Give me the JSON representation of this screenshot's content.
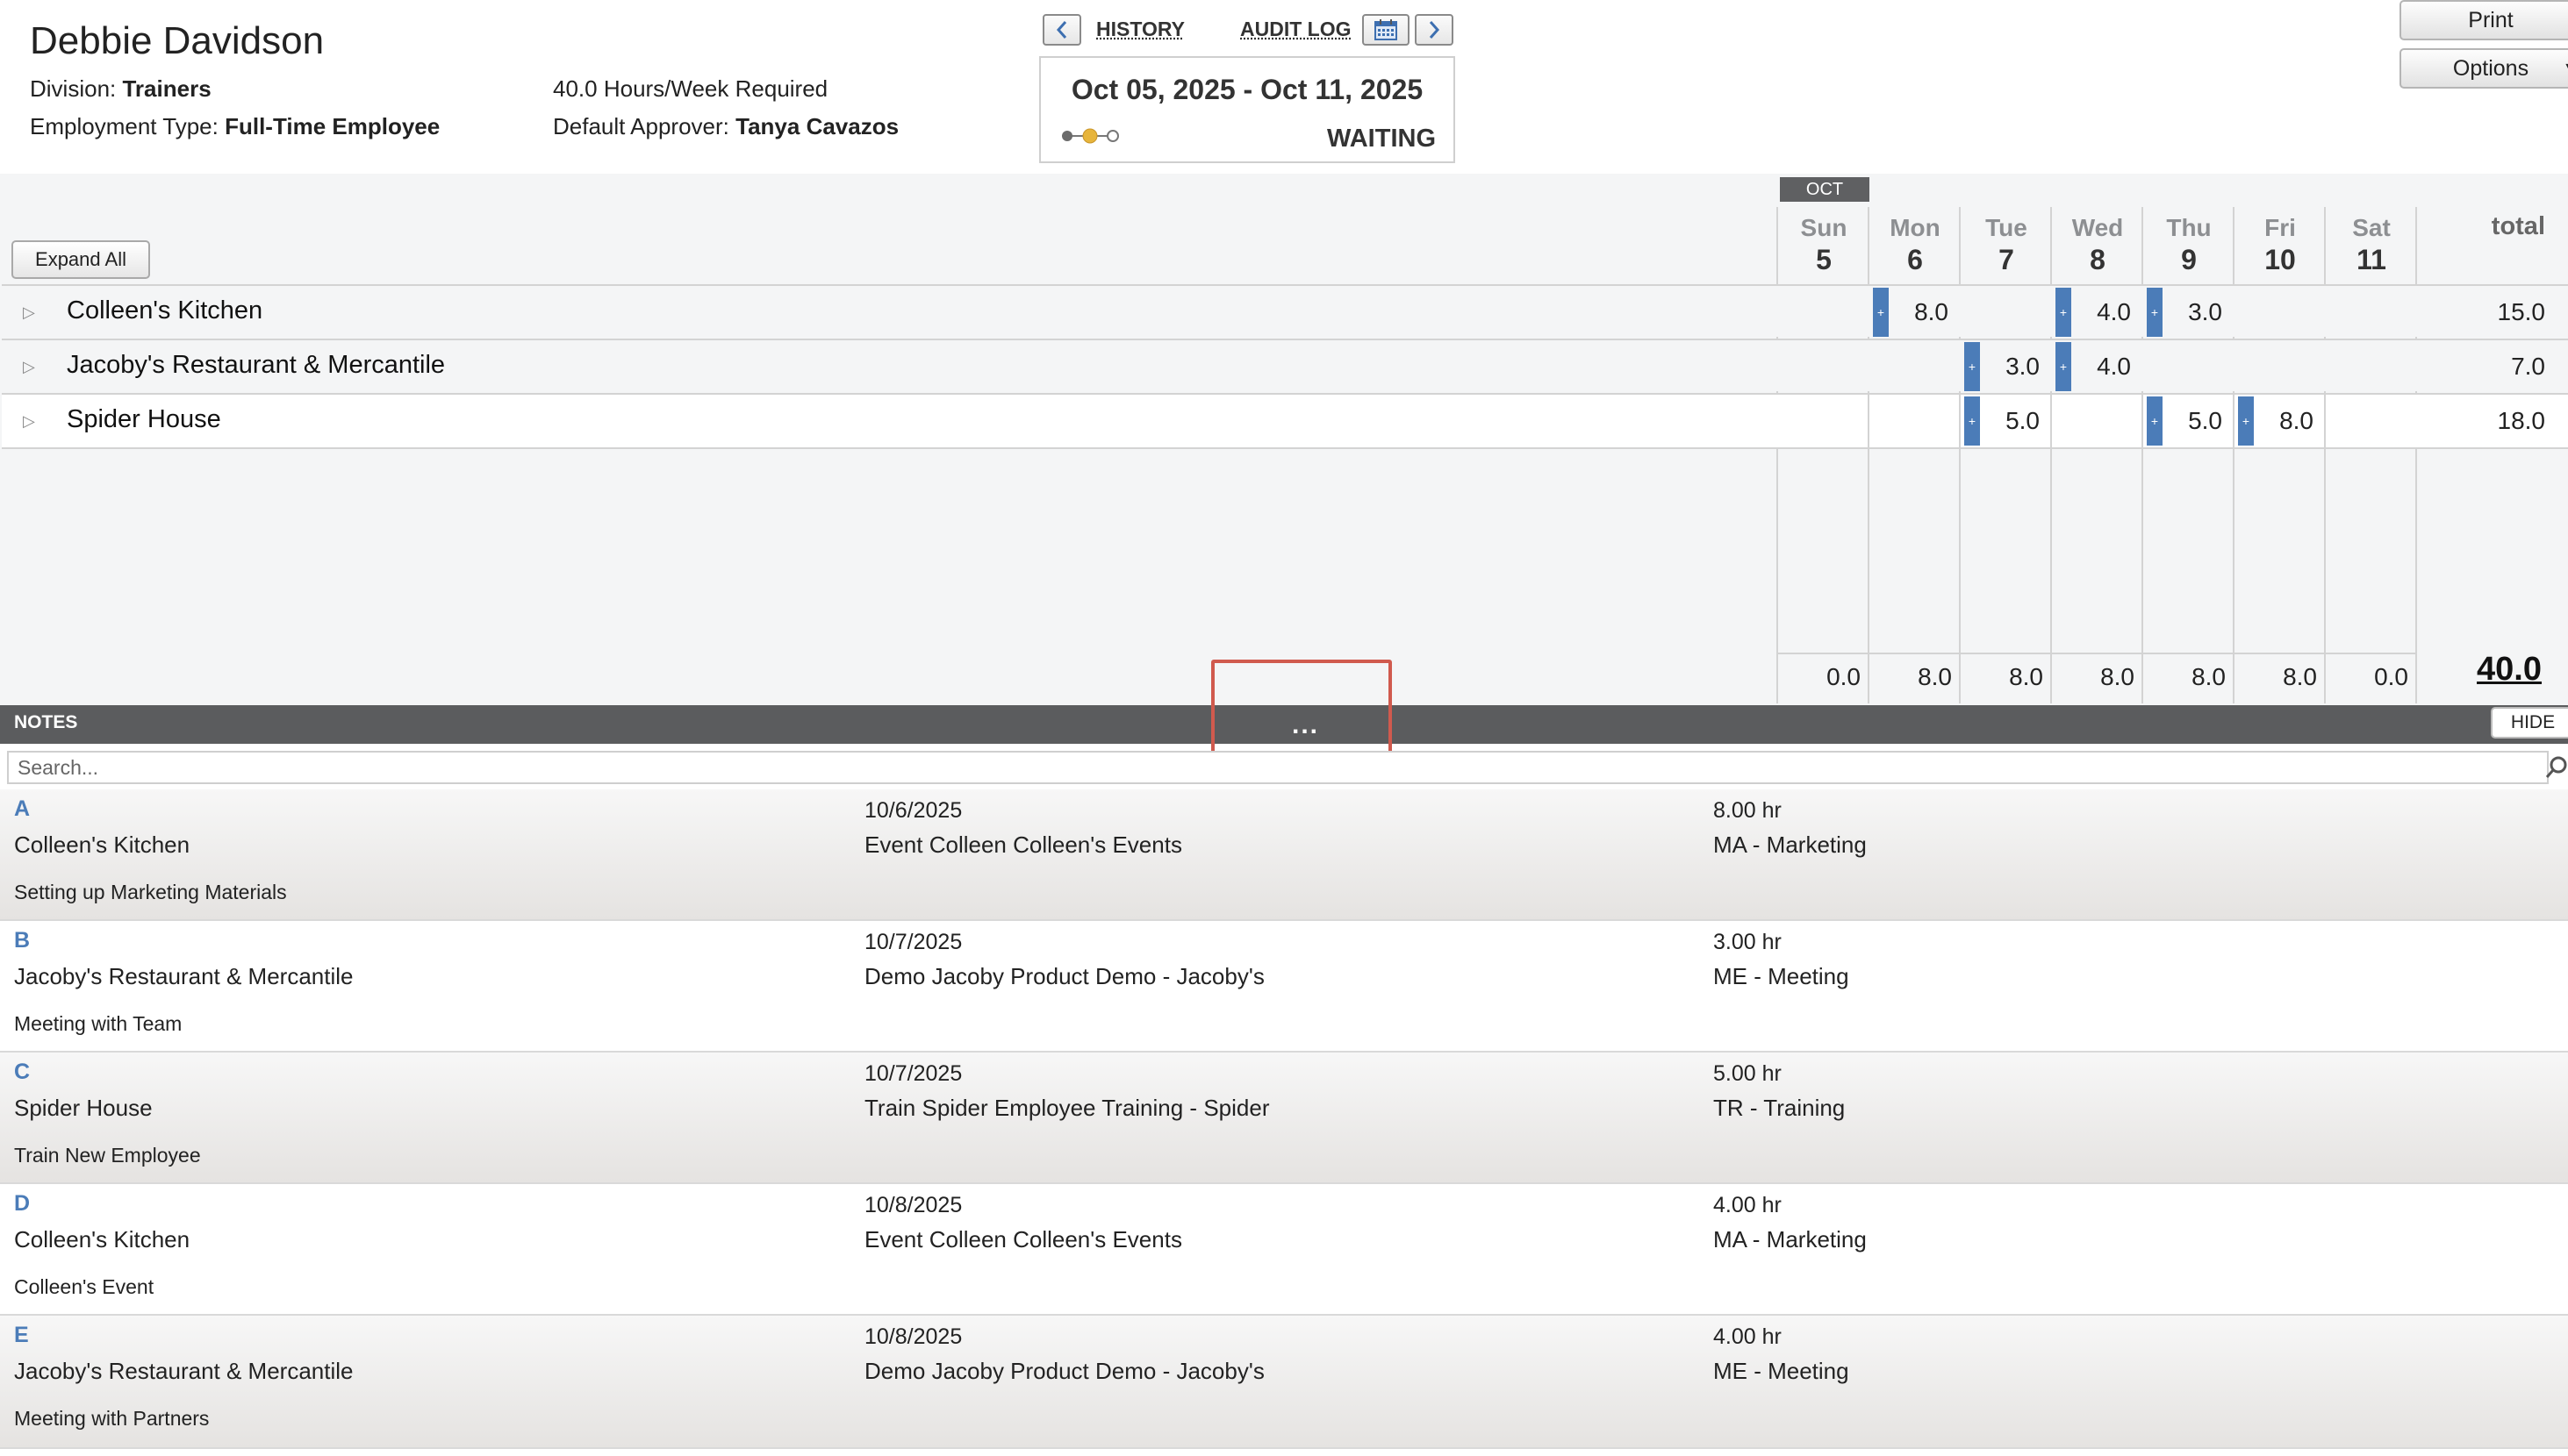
{
  "header": {
    "employee_name": "Debbie Davidson",
    "division_label": "Division:",
    "division_value": "Trainers",
    "employment_label": "Employment Type:",
    "employment_value": "Full-Time Employee",
    "hours_required": "40.0 Hours/Week Required",
    "approver_label": "Default Approver:",
    "approver_value": "Tanya Cavazos"
  },
  "nav": {
    "prev_icon": "chevron-left-icon",
    "history": "HISTORY",
    "audit_log": "AUDIT LOG",
    "calendar_icon": "calendar-icon",
    "next_icon": "chevron-right-icon",
    "period_range": "Oct 05, 2025 - Oct 11, 2025",
    "status": "WAITING"
  },
  "actions": {
    "print": "Print",
    "options": "Options"
  },
  "grid": {
    "expand_all": "Expand All",
    "month": "OCT",
    "total_label": "total",
    "days": [
      {
        "name": "Sun",
        "date": "5"
      },
      {
        "name": "Mon",
        "date": "6"
      },
      {
        "name": "Tue",
        "date": "7"
      },
      {
        "name": "Wed",
        "date": "8"
      },
      {
        "name": "Thu",
        "date": "9"
      },
      {
        "name": "Fri",
        "date": "10"
      },
      {
        "name": "Sat",
        "date": "11"
      }
    ],
    "rows": [
      {
        "name": "Colleen's Kitchen",
        "values": [
          "",
          "8.0",
          "",
          "4.0",
          "3.0",
          "",
          ""
        ],
        "total": "15.0"
      },
      {
        "name": "Jacoby's Restaurant & Mercantile",
        "values": [
          "",
          "",
          "3.0",
          "4.0",
          "",
          "",
          ""
        ],
        "total": "7.0"
      },
      {
        "name": "Spider House",
        "values": [
          "",
          "",
          "5.0",
          "",
          "5.0",
          "8.0",
          ""
        ],
        "total": "18.0"
      }
    ],
    "day_totals": [
      "0.0",
      "8.0",
      "8.0",
      "8.0",
      "8.0",
      "8.0",
      "0.0"
    ],
    "grand_total": "40.0"
  },
  "notes": {
    "title": "NOTES",
    "hide": "HIDE",
    "drag_handle": "...",
    "search_placeholder": "Search...",
    "items": [
      {
        "letter": "A",
        "project": "Colleen's Kitchen",
        "description": "Setting up Marketing Materials",
        "date": "10/6/2025",
        "event": "Event Colleen Colleen's Events",
        "hours": "8.00 hr",
        "category": "MA - Marketing"
      },
      {
        "letter": "B",
        "project": "Jacoby's Restaurant & Mercantile",
        "description": "Meeting with Team",
        "date": "10/7/2025",
        "event": "Demo Jacoby Product Demo - Jacoby's",
        "hours": "3.00 hr",
        "category": "ME - Meeting"
      },
      {
        "letter": "C",
        "project": "Spider House",
        "description": "Train New Employee",
        "date": "10/7/2025",
        "event": "Train Spider Employee Training - Spider",
        "hours": "5.00 hr",
        "category": "TR - Training"
      },
      {
        "letter": "D",
        "project": "Colleen's Kitchen",
        "description": "Colleen's Event",
        "date": "10/8/2025",
        "event": "Event Colleen Colleen's Events",
        "hours": "4.00 hr",
        "category": "MA - Marketing"
      },
      {
        "letter": "E",
        "project": "Jacoby's Restaurant & Mercantile",
        "description": "Meeting with Partners",
        "date": "10/8/2025",
        "event": "Demo Jacoby Product Demo - Jacoby's",
        "hours": "4.00 hr",
        "category": "ME - Meeting"
      }
    ]
  },
  "colors": {
    "accent_blue": "#4b7cb8",
    "notes_bar": "#5b5c5e",
    "highlight_red": "#d05a4e",
    "status_yellow": "#e7b53c"
  }
}
